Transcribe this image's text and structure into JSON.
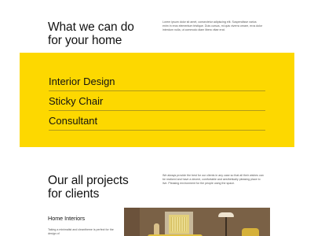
{
  "services_section": {
    "title_line1": "What we can do",
    "title_line2": "for your home",
    "paragraph": "Lorem ipsum dolor sit amet, consectetur adipiscing elit. Suspendisse varius enim in eros elementum tristique. Duis cursus, mi quis viverra ornare, eros dolor interdum nulla, ut commodo diam libero vitae erat.",
    "panel_color": "#fdd800",
    "services": [
      {
        "label": "Interior Design"
      },
      {
        "label": "Sticky Chair"
      },
      {
        "label": "Consultant"
      }
    ]
  },
  "projects_section": {
    "title_line1": "Our all projects",
    "title_line2": "for clients",
    "paragraph": "We always provide the best for our clients in any case so that all their wishes can be realized and have a decent, comfortable and aesthetically pleasing place to live. Pleasing environment for the people using the space.",
    "project": {
      "title": "Home Interiors",
      "description": "Taking a minimalist and cleantheme is perfect for the design of"
    }
  }
}
